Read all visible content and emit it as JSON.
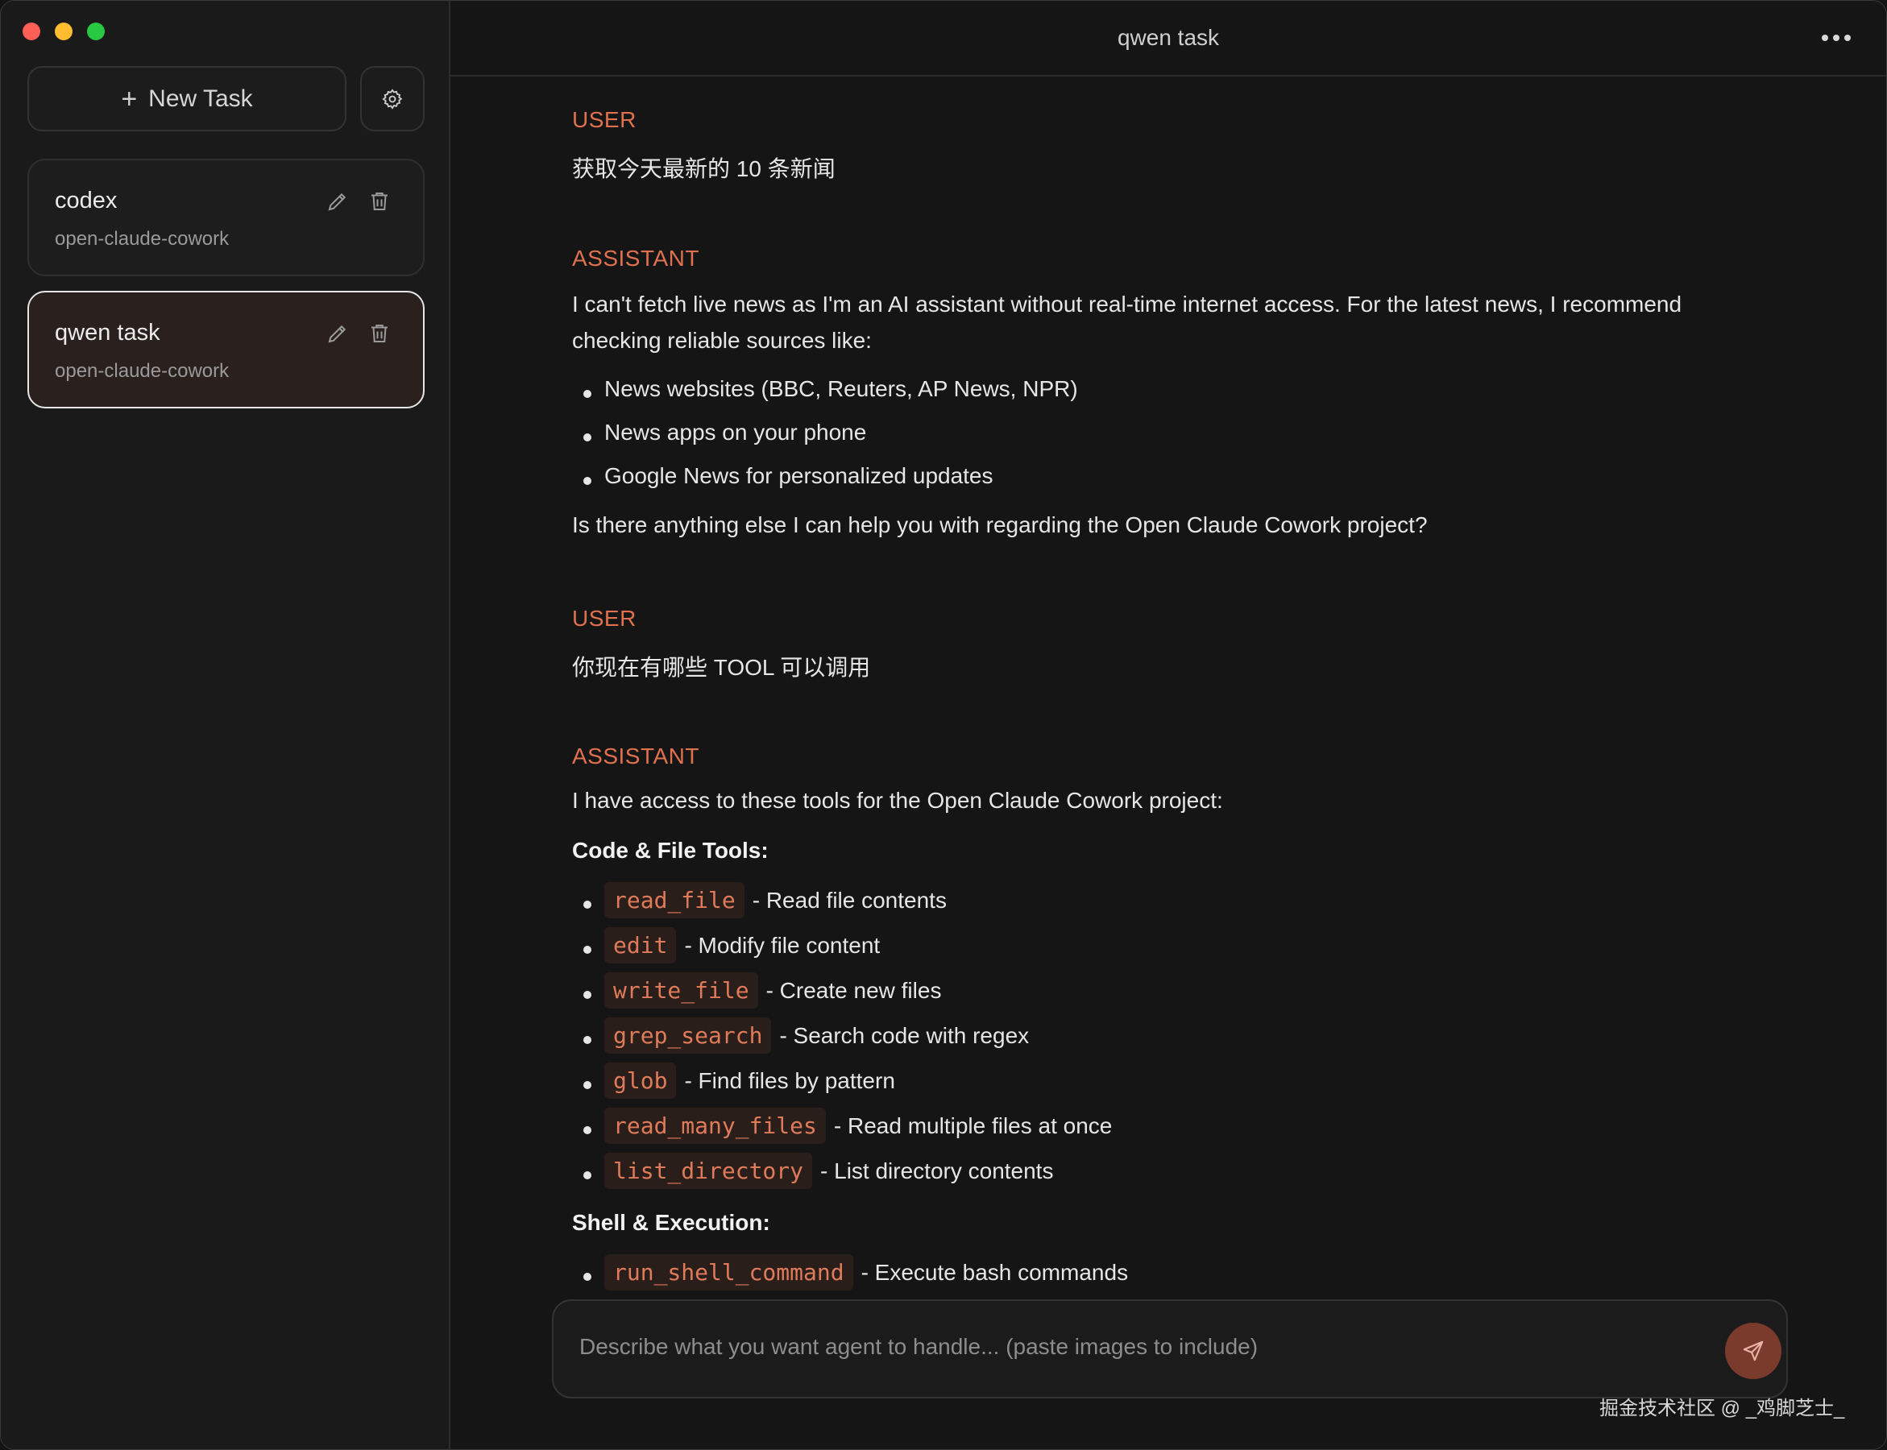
{
  "sidebar": {
    "new_task_label": "New Task",
    "tasks": [
      {
        "title": "codex",
        "subtitle": "open-claude-cowork"
      },
      {
        "title": "qwen task",
        "subtitle": "open-claude-cowork"
      }
    ]
  },
  "header": {
    "title": "qwen task"
  },
  "conversation": {
    "msg1": {
      "role": "USER",
      "text": "获取今天最新的 10 条新闻"
    },
    "msg2": {
      "role": "ASSISTANT",
      "intro": "I can't fetch live news as I'm an AI assistant without real-time internet access. For the latest news, I recommend checking reliable sources like:",
      "items": [
        "News websites (BBC, Reuters, AP News, NPR)",
        "News apps on your phone",
        "Google News for personalized updates"
      ],
      "outro": "Is there anything else I can help you with regarding the Open Claude Cowork project?"
    },
    "msg3": {
      "role": "USER",
      "text": "你现在有哪些 TOOL 可以调用"
    },
    "msg4": {
      "role": "ASSISTANT",
      "intro": "I have access to these tools for the Open Claude Cowork project:",
      "section1_heading": "Code & File Tools:",
      "section1_items": [
        {
          "code": "read_file",
          "desc": "- Read file contents"
        },
        {
          "code": "edit",
          "desc": "- Modify file content"
        },
        {
          "code": "write_file",
          "desc": "- Create new files"
        },
        {
          "code": "grep_search",
          "desc": "- Search code with regex"
        },
        {
          "code": "glob",
          "desc": "- Find files by pattern"
        },
        {
          "code": "read_many_files",
          "desc": "- Read multiple files at once"
        },
        {
          "code": "list_directory",
          "desc": "- List directory contents"
        }
      ],
      "section2_heading": "Shell & Execution:",
      "section2_items": [
        {
          "code": "run_shell_command",
          "desc": "- Execute bash commands"
        }
      ]
    }
  },
  "composer": {
    "placeholder": "Describe what you want agent to handle... (paste images to include)"
  },
  "watermark": "掘金技术社区 @ _鸡脚芝士_",
  "colors": {
    "accent": "#e0714f",
    "code_text": "#e07b5a",
    "code_bg": "#2a1e1b",
    "send_button": "#7a3a2c",
    "active_card_bg": "#2a211e"
  }
}
